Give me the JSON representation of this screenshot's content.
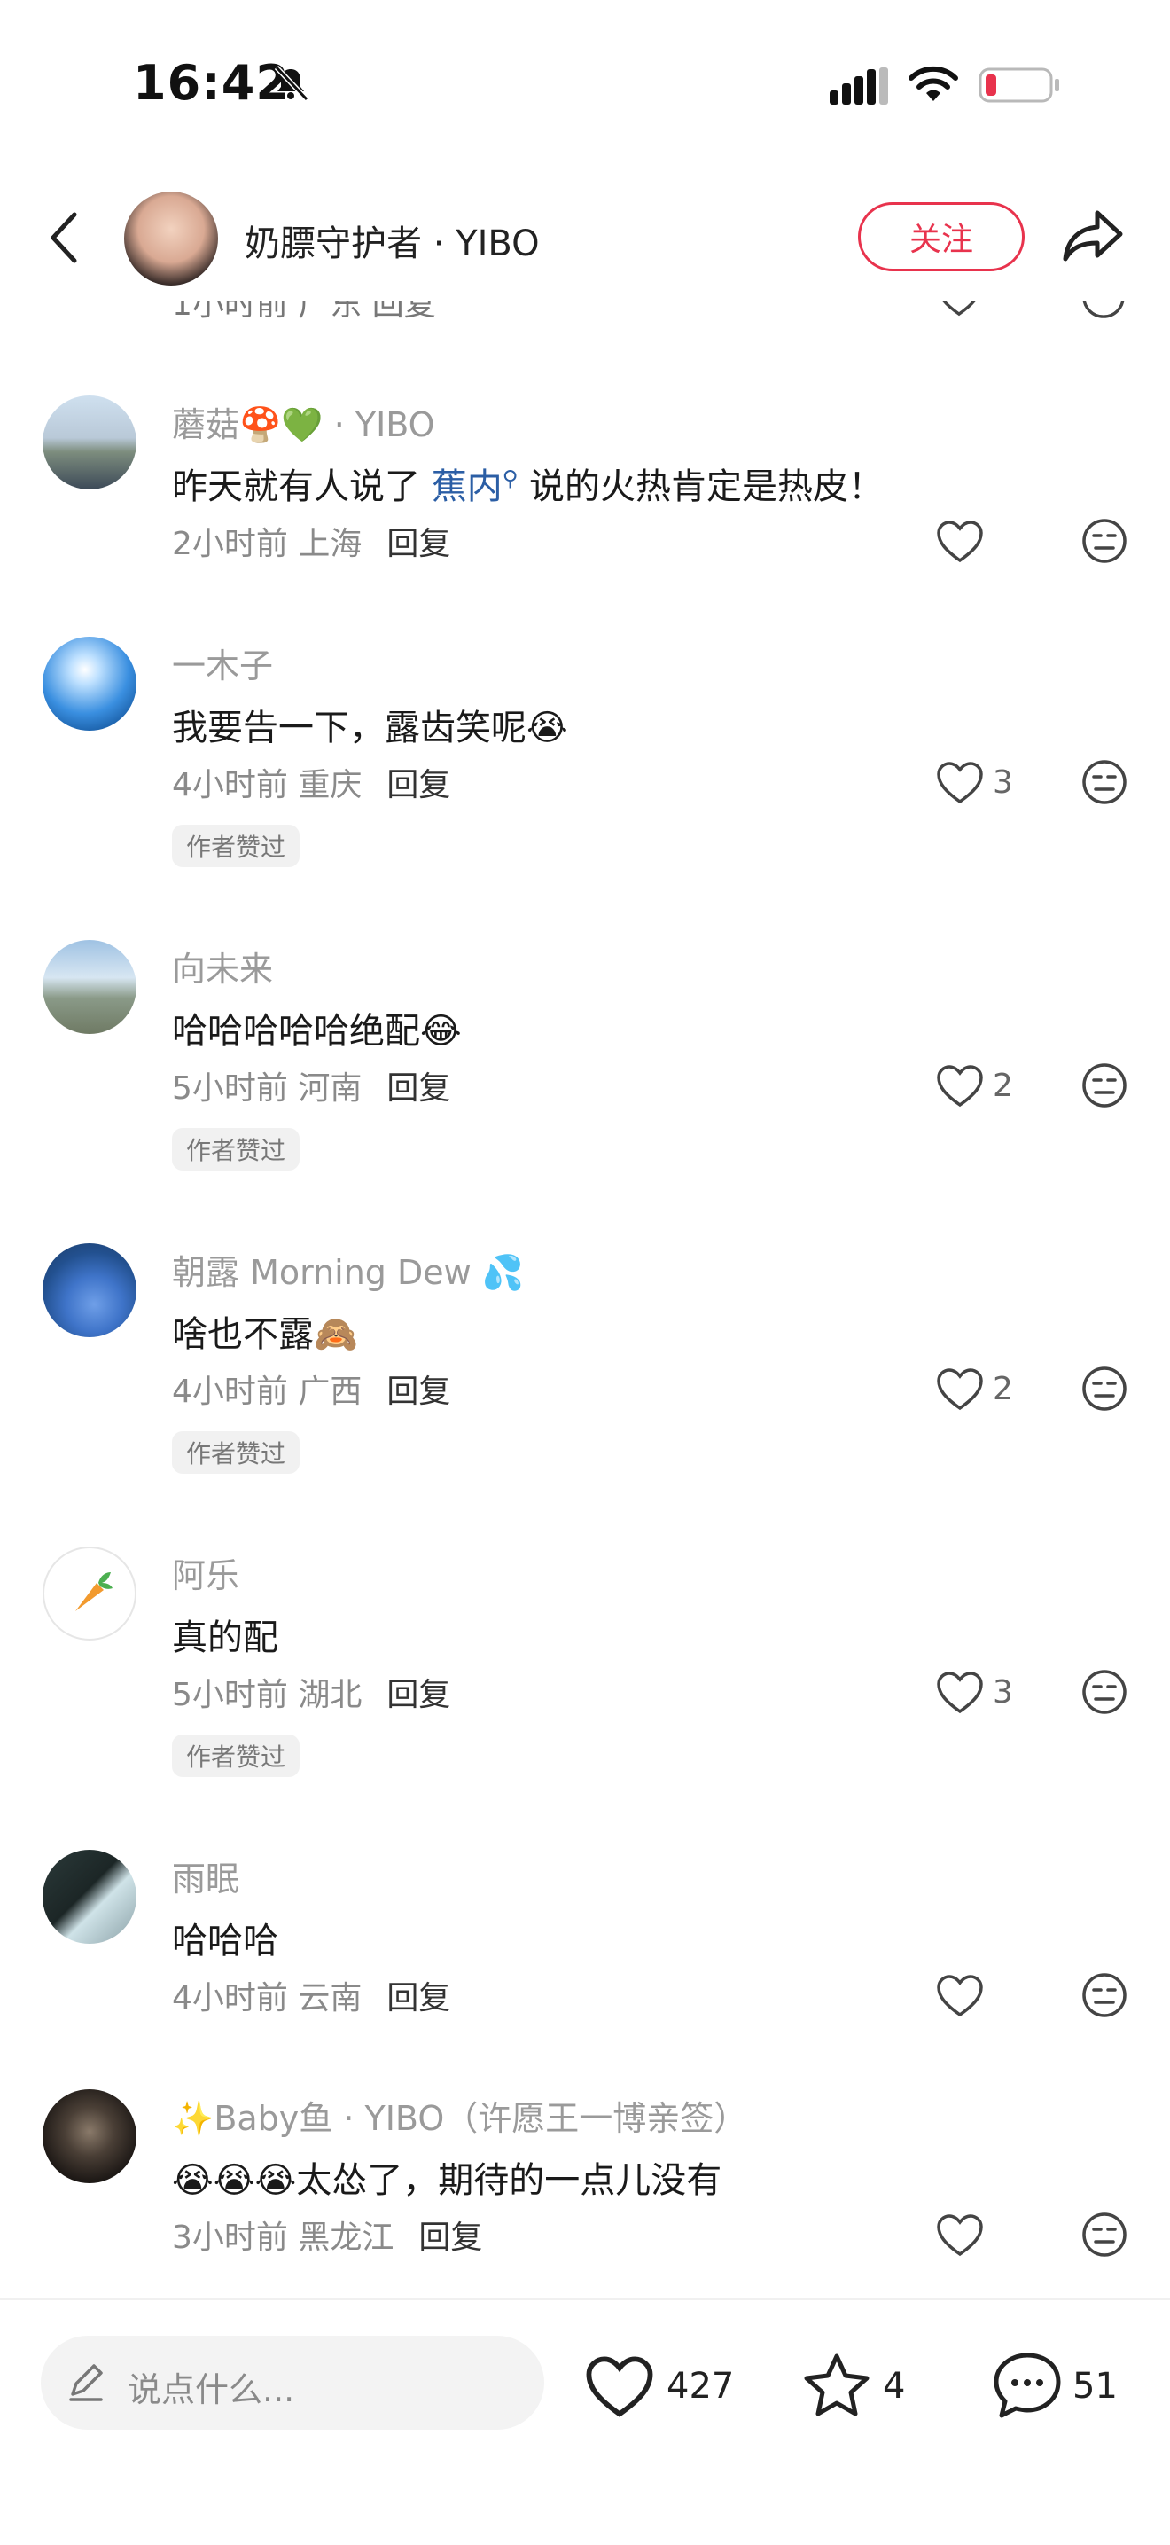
{
  "status_bar": {
    "time": "16:42"
  },
  "header": {
    "author_name": "奶膘守护者 · YIBO",
    "follow_label": "关注"
  },
  "peek": {
    "meta": "1小时前 广东  回复"
  },
  "comments": [
    {
      "user": "蘑菇🍄💚 · YIBO",
      "text_before": "昨天就有人说了 ",
      "topic": "蕉内",
      "text_after": " 说的火热肯定是热皮！",
      "time": "2小时前",
      "location": "上海",
      "reply": "回复",
      "likes": "",
      "badge": ""
    },
    {
      "user": "一木子",
      "text": "我要告一下，露齿笑呢😭",
      "time": "4小时前",
      "location": "重庆",
      "reply": "回复",
      "likes": "3",
      "badge": "作者赞过"
    },
    {
      "user": "向未来",
      "text": "哈哈哈哈哈绝配😂",
      "time": "5小时前",
      "location": "河南",
      "reply": "回复",
      "likes": "2",
      "badge": "作者赞过"
    },
    {
      "user": "朝露 Morning Dew 💦",
      "text": "啥也不露🙈",
      "time": "4小时前",
      "location": "广西",
      "reply": "回复",
      "likes": "2",
      "badge": "作者赞过"
    },
    {
      "user": "阿乐",
      "text": "真的配",
      "time": "5小时前",
      "location": "湖北",
      "reply": "回复",
      "likes": "3",
      "badge": "作者赞过"
    },
    {
      "user": "雨眠",
      "text": "哈哈哈",
      "time": "4小时前",
      "location": "云南",
      "reply": "回复",
      "likes": "",
      "badge": ""
    },
    {
      "user": "✨Baby鱼 · YIBO（许愿王一博亲签）",
      "text": "😭😭😭太怂了，期待的一点儿没有",
      "time": "3小时前",
      "location": "黑龙江",
      "reply": "回复",
      "likes": "",
      "badge": ""
    }
  ],
  "bottom_bar": {
    "placeholder": "说点什么...",
    "likes": "427",
    "stars": "4",
    "comments": "51"
  },
  "colors": {
    "accent": "#e8334d",
    "topic": "#2b5ea5"
  }
}
